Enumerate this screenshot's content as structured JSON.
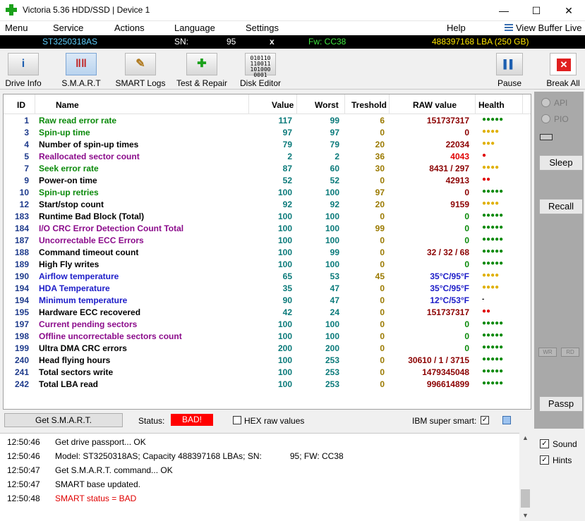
{
  "window": {
    "title": "Victoria 5.36 HDD/SSD | Device 1",
    "minimize": "—",
    "maximize": "☐",
    "close": "✕"
  },
  "menu": {
    "items": [
      "Menu",
      "Service",
      "Actions",
      "Language",
      "Settings",
      "Help"
    ],
    "view_buffer": "View Buffer Live"
  },
  "info": {
    "model": "ST3250318AS",
    "sn_label": "SN:",
    "sn_value": "95",
    "x": "x",
    "fw": "Fw: CC38",
    "lba": "488397168 LBA (250 GB)"
  },
  "toolbar": {
    "buttons": [
      "Drive Info",
      "S.M.A.R.T",
      "SMART Logs",
      "Test & Repair",
      "Disk Editor"
    ],
    "pause": "Pause",
    "break_all": "Break All",
    "disk_editor_glyph": "010110\n110011\n101000\n0001"
  },
  "table": {
    "headers": {
      "id": "ID",
      "name": "Name",
      "value": "Value",
      "worst": "Worst",
      "threshold": "Treshold",
      "raw": "RAW value",
      "health": "Health"
    },
    "rows": [
      {
        "id": "1",
        "name": "Raw read error rate",
        "value": "117",
        "worst": "99",
        "threshold": "6",
        "raw": "151737317",
        "health": "●●●●●",
        "name_color": "#0a8a0a",
        "raw_color": "#8b0000",
        "health_color": "#0a8a0a"
      },
      {
        "id": "3",
        "name": "Spin-up time",
        "value": "97",
        "worst": "97",
        "threshold": "0",
        "raw": "0",
        "health": "●●●●",
        "name_color": "#0a8a0a",
        "raw_color": "#8b0000",
        "health_color": "#e0b000"
      },
      {
        "id": "4",
        "name": "Number of spin-up times",
        "value": "79",
        "worst": "79",
        "threshold": "20",
        "raw": "22034",
        "health": "●●●",
        "name_color": "#000000",
        "raw_color": "#8b0000",
        "health_color": "#e0b000"
      },
      {
        "id": "5",
        "name": "Reallocated sector count",
        "value": "2",
        "worst": "2",
        "threshold": "36",
        "raw": "4043",
        "health": "●",
        "name_color": "#8b0b8b",
        "raw_color": "#e00000",
        "health_color": "#e00000"
      },
      {
        "id": "7",
        "name": "Seek error rate",
        "value": "87",
        "worst": "60",
        "threshold": "30",
        "raw": "8431 / 297",
        "health": "●●●●",
        "name_color": "#0a8a0a",
        "raw_color": "#8b0000",
        "health_color": "#e0b000"
      },
      {
        "id": "9",
        "name": "Power-on time",
        "value": "52",
        "worst": "52",
        "threshold": "0",
        "raw": "42913",
        "health": "●●",
        "name_color": "#000000",
        "raw_color": "#8b0000",
        "health_color": "#e00000"
      },
      {
        "id": "10",
        "name": "Spin-up retries",
        "value": "100",
        "worst": "100",
        "threshold": "97",
        "raw": "0",
        "health": "●●●●●",
        "name_color": "#0a8a0a",
        "raw_color": "#8b0000",
        "health_color": "#0a8a0a"
      },
      {
        "id": "12",
        "name": "Start/stop count",
        "value": "92",
        "worst": "92",
        "threshold": "20",
        "raw": "9159",
        "health": "●●●●",
        "name_color": "#000000",
        "raw_color": "#8b0000",
        "health_color": "#e0b000"
      },
      {
        "id": "183",
        "name": "Runtime Bad Block (Total)",
        "value": "100",
        "worst": "100",
        "threshold": "0",
        "raw": "0",
        "health": "●●●●●",
        "name_color": "#000000",
        "raw_color": "#0a8a0a",
        "health_color": "#0a8a0a"
      },
      {
        "id": "184",
        "name": "I/O CRC Error Detection Count Total",
        "value": "100",
        "worst": "100",
        "threshold": "99",
        "raw": "0",
        "health": "●●●●●",
        "name_color": "#8b0b8b",
        "raw_color": "#0a8a0a",
        "health_color": "#0a8a0a"
      },
      {
        "id": "187",
        "name": "Uncorrectable ECC Errors",
        "value": "100",
        "worst": "100",
        "threshold": "0",
        "raw": "0",
        "health": "●●●●●",
        "name_color": "#8b0b8b",
        "raw_color": "#0a8a0a",
        "health_color": "#0a8a0a"
      },
      {
        "id": "188",
        "name": "Command timeout count",
        "value": "100",
        "worst": "99",
        "threshold": "0",
        "raw": "32 / 32 / 68",
        "health": "●●●●●",
        "name_color": "#000000",
        "raw_color": "#8b0000",
        "health_color": "#0a8a0a"
      },
      {
        "id": "189",
        "name": "High Fly writes",
        "value": "100",
        "worst": "100",
        "threshold": "0",
        "raw": "0",
        "health": "●●●●●",
        "name_color": "#000000",
        "raw_color": "#0a8a0a",
        "health_color": "#0a8a0a"
      },
      {
        "id": "190",
        "name": "Airflow temperature",
        "value": "65",
        "worst": "53",
        "threshold": "45",
        "raw": "35°C/95°F",
        "health": "●●●●",
        "name_color": "#1c1cc8",
        "raw_color": "#1c1cc8",
        "health_color": "#e0b000"
      },
      {
        "id": "194",
        "name": "HDA Temperature",
        "value": "35",
        "worst": "47",
        "threshold": "0",
        "raw": "35°C/95°F",
        "health": "●●●●",
        "name_color": "#1c1cc8",
        "raw_color": "#1c1cc8",
        "health_color": "#e0b000"
      },
      {
        "id": "194",
        "name": "Minimum temperature",
        "value": "90",
        "worst": "47",
        "threshold": "0",
        "raw": "12°C/53°F",
        "health": "-",
        "name_color": "#1c1cc8",
        "raw_color": "#1c1cc8",
        "health_color": "#000000"
      },
      {
        "id": "195",
        "name": "Hardware ECC recovered",
        "value": "42",
        "worst": "24",
        "threshold": "0",
        "raw": "151737317",
        "health": "●●",
        "name_color": "#000000",
        "raw_color": "#8b0000",
        "health_color": "#e00000"
      },
      {
        "id": "197",
        "name": "Current pending sectors",
        "value": "100",
        "worst": "100",
        "threshold": "0",
        "raw": "0",
        "health": "●●●●●",
        "name_color": "#8b0b8b",
        "raw_color": "#0a8a0a",
        "health_color": "#0a8a0a"
      },
      {
        "id": "198",
        "name": "Offline uncorrectable sectors count",
        "value": "100",
        "worst": "100",
        "threshold": "0",
        "raw": "0",
        "health": "●●●●●",
        "name_color": "#8b0b8b",
        "raw_color": "#0a8a0a",
        "health_color": "#0a8a0a"
      },
      {
        "id": "199",
        "name": "Ultra DMA CRC errors",
        "value": "200",
        "worst": "200",
        "threshold": "0",
        "raw": "0",
        "health": "●●●●●",
        "name_color": "#000000",
        "raw_color": "#0a8a0a",
        "health_color": "#0a8a0a"
      },
      {
        "id": "240",
        "name": "Head flying hours",
        "value": "100",
        "worst": "253",
        "threshold": "0",
        "raw": "30610 / 1 / 3715",
        "health": "●●●●●",
        "name_color": "#000000",
        "raw_color": "#8b0000",
        "health_color": "#0a8a0a"
      },
      {
        "id": "241",
        "name": "Total sectors write",
        "value": "100",
        "worst": "253",
        "threshold": "0",
        "raw": "1479345048",
        "health": "●●●●●",
        "name_color": "#000000",
        "raw_color": "#8b0000",
        "health_color": "#0a8a0a"
      },
      {
        "id": "242",
        "name": "Total LBA read",
        "value": "100",
        "worst": "253",
        "threshold": "0",
        "raw": "996614899",
        "health": "●●●●●",
        "name_color": "#000000",
        "raw_color": "#8b0000",
        "health_color": "#0a8a0a"
      }
    ]
  },
  "bottom": {
    "get_smart": "Get S.M.A.R.T.",
    "status_label": "Status:",
    "status_value": "BAD!",
    "hex_label": "HEX raw values",
    "ibm_label": "IBM super smart:",
    "ibm_checked": "✓"
  },
  "right_panel": {
    "api": "API",
    "pio": "PIO",
    "sleep": "Sleep",
    "recall": "Recall",
    "wr": "WR",
    "rd": "RD",
    "passp": "Passp"
  },
  "log": [
    {
      "time": "12:50:46",
      "text": "Get drive passport... OK",
      "color": "#000000"
    },
    {
      "time": "12:50:46",
      "text": "Model: ST3250318AS; Capacity 488397168 LBAs; SN:            95; FW: CC38",
      "color": "#000000"
    },
    {
      "time": "12:50:47",
      "text": "Get S.M.A.R.T. command... OK",
      "color": "#000000"
    },
    {
      "time": "12:50:47",
      "text": "SMART base updated.",
      "color": "#000000"
    },
    {
      "time": "12:50:48",
      "text": "SMART status = BAD",
      "color": "#e00000"
    }
  ],
  "options": {
    "sound": "Sound",
    "hints": "Hints",
    "check": "✓"
  }
}
